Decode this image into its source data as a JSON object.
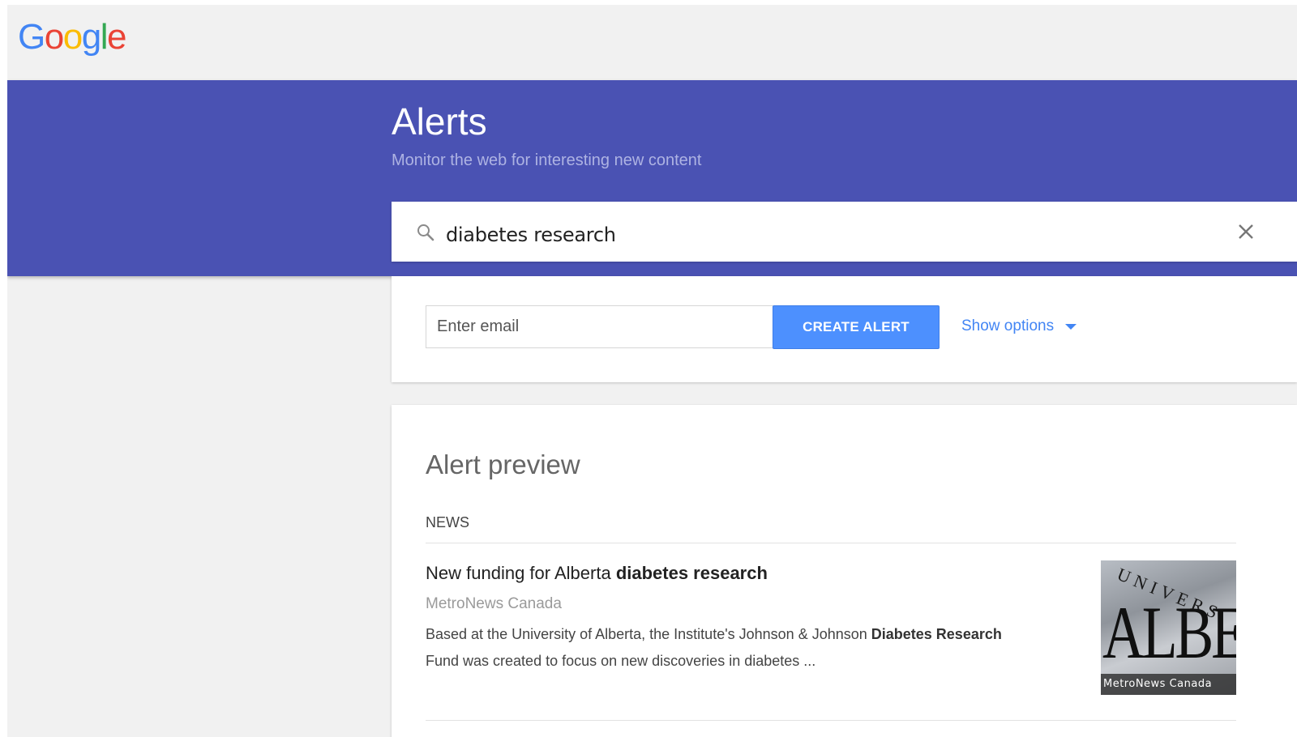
{
  "logo": {
    "text": "Google",
    "letters": [
      "G",
      "o",
      "o",
      "g",
      "l",
      "e"
    ]
  },
  "header": {
    "title": "Alerts",
    "subtitle": "Monitor the web for interesting new content"
  },
  "search": {
    "query": "diabetes research",
    "search_icon": "search-icon",
    "clear_icon": "close-icon"
  },
  "options": {
    "email_placeholder": "Enter email",
    "email_value": "",
    "create_label": "CREATE ALERT",
    "show_options_label": "Show options"
  },
  "preview": {
    "title": "Alert preview",
    "section": "NEWS",
    "results": [
      {
        "title_plain": "New funding for Alberta ",
        "title_bold": "diabetes research",
        "source": "MetroNews Canada",
        "snippet_1": "Based at the University of Alberta, the Institute's Johnson & Johnson ",
        "snippet_bold": "Diabetes Research",
        "snippet_2": "Fund was created to focus on new discoveries in diabetes ...",
        "thumb_big_text": "ALBE",
        "thumb_small_text": "UNIVERS",
        "thumb_caption": "MetroNews Canada"
      }
    ]
  },
  "colors": {
    "banner": "#4a52b3",
    "button": "#4d90fe",
    "link": "#4285f4",
    "background": "#f1f1f1"
  }
}
